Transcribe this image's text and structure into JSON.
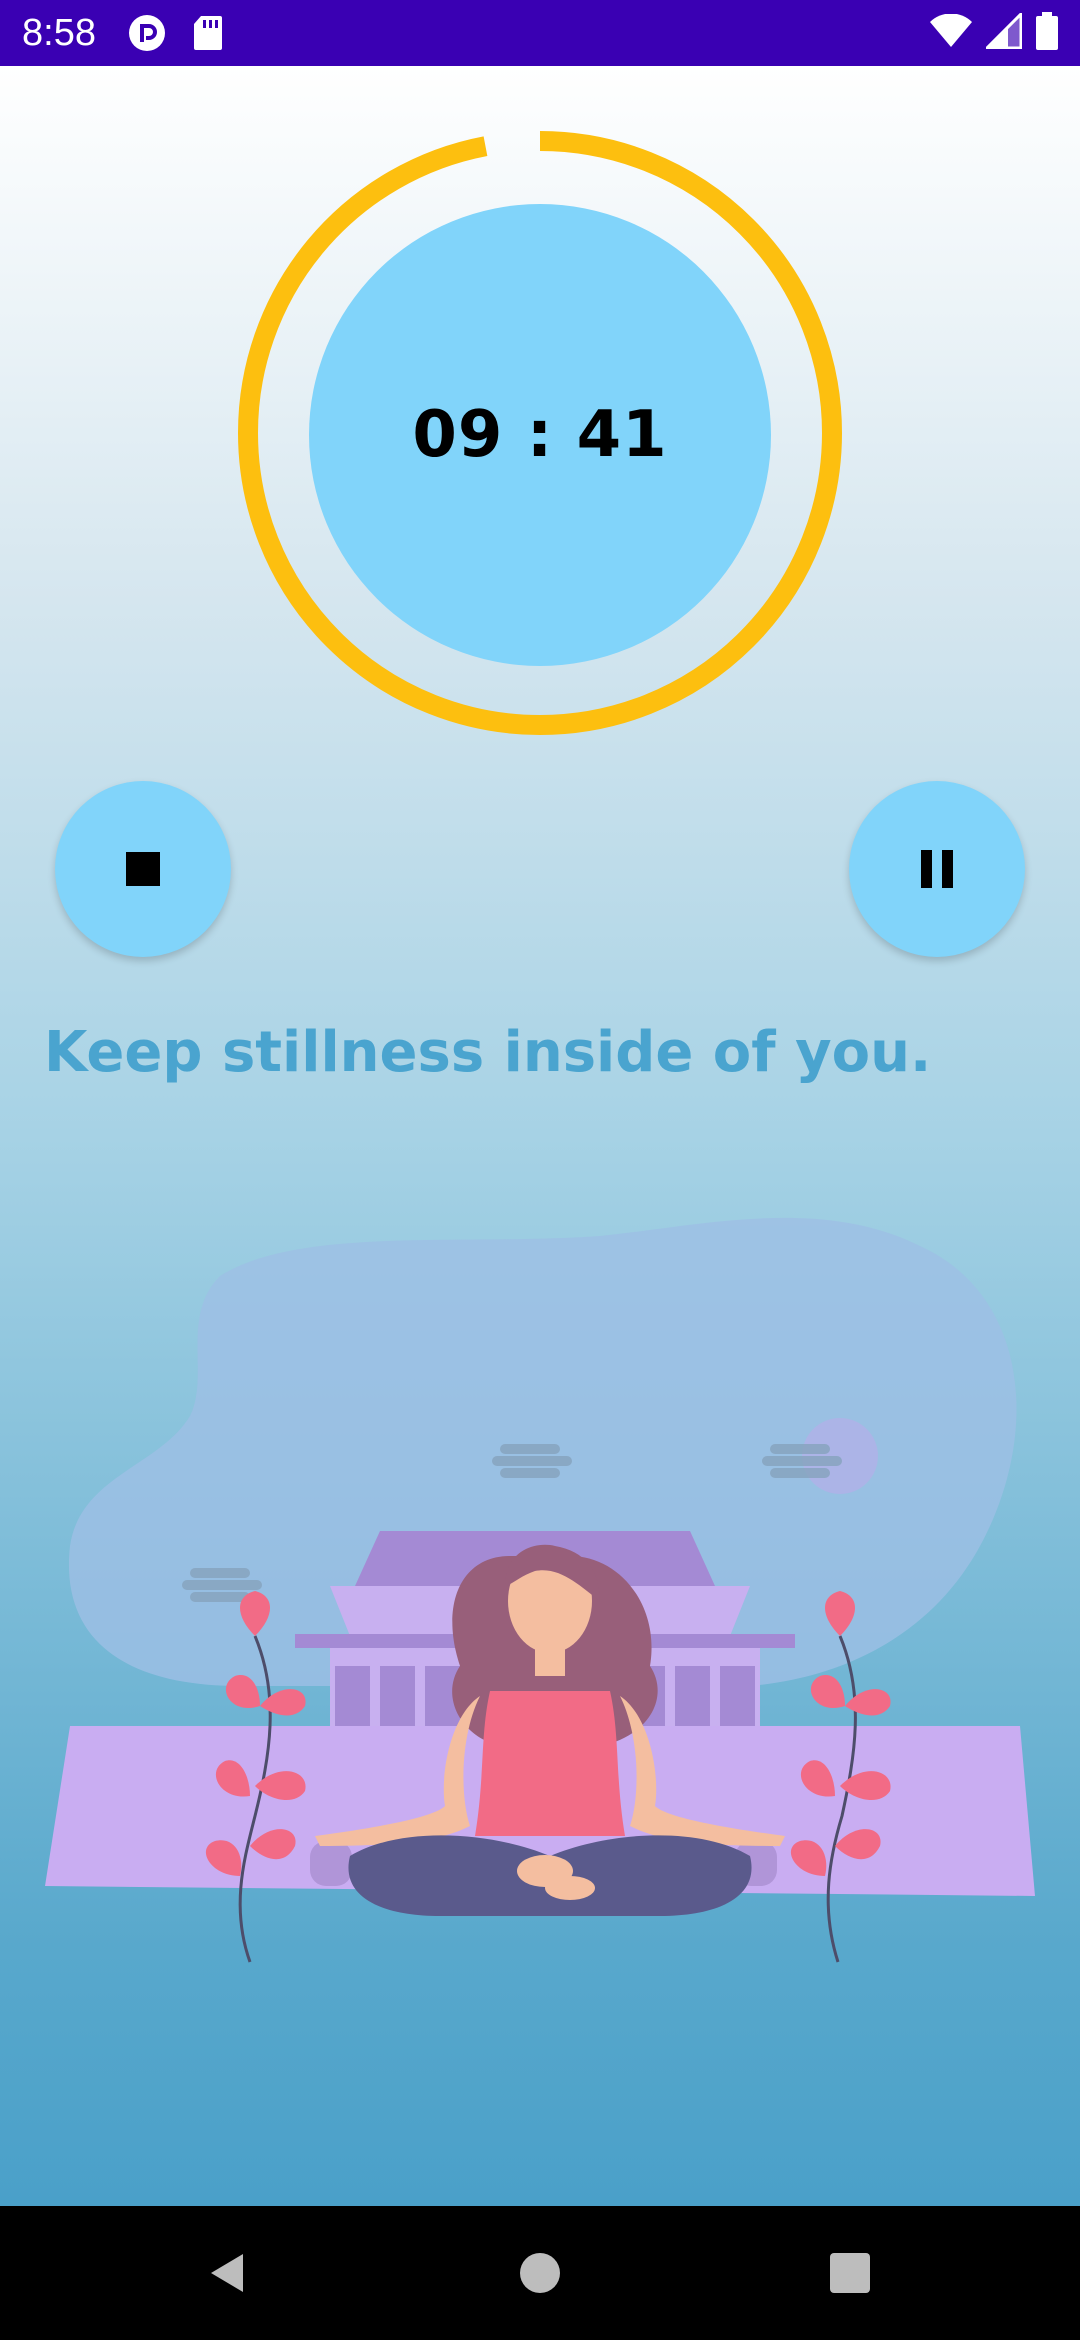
{
  "status_bar": {
    "time": "8:58",
    "background_color": "#3a00b3",
    "left_icons": [
      "pocket-casts-icon",
      "sd-card-icon"
    ],
    "right_icons": [
      "wifi-icon",
      "cell-signal-icon",
      "battery-icon"
    ]
  },
  "timer": {
    "display": "09 : 41",
    "progress": 0.97,
    "ring_color": "#fdbf0f",
    "face_color": "#81d4fa"
  },
  "controls": {
    "stop_icon": "stop-icon",
    "pause_icon": "pause-icon"
  },
  "quote": {
    "text": "Keep stillness inside of you.",
    "color": "#4aa4cf"
  },
  "illustration": {
    "subject": "woman-meditating-temple-illustration"
  },
  "nav_bar": {
    "back_icon": "back-triangle-icon",
    "home_icon": "home-circle-icon",
    "recents_icon": "recents-square-icon"
  }
}
